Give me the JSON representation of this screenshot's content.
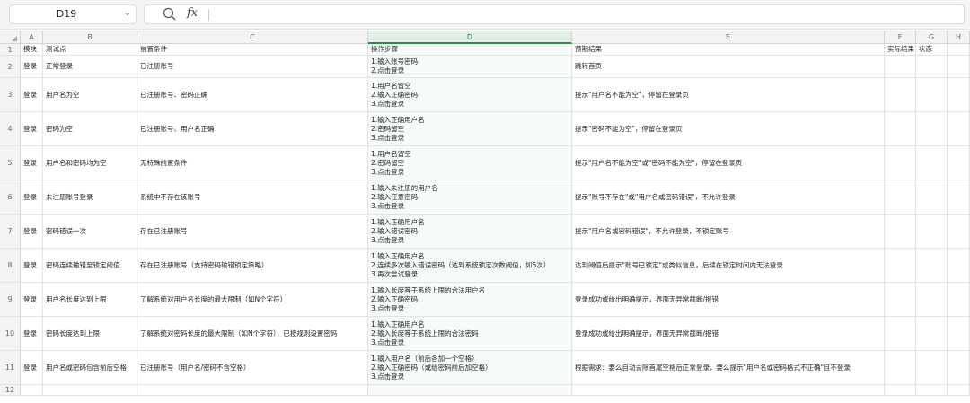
{
  "namebox": {
    "value": "D19"
  },
  "formula": {
    "value": ""
  },
  "columns": [
    "A",
    "B",
    "C",
    "D",
    "E",
    "F",
    "G",
    "H"
  ],
  "selected_column": "D",
  "headers": {
    "A": "模块",
    "B": "测试点",
    "C": "前置条件",
    "D": "操作步骤",
    "E": "预期结果",
    "F": "实际结果",
    "G": "状态"
  },
  "rows": [
    {
      "num": "2",
      "A": "登录",
      "B": "正常登录",
      "C": "已注册账号",
      "D": [
        "1.输入账号密码",
        "2.点击登录"
      ],
      "E": "跳转首页"
    },
    {
      "num": "3",
      "A": "登录",
      "B": "用户名为空",
      "C": "已注册账号、密码正确",
      "D": [
        "1.用户名留空",
        "2.输入正确密码",
        "3.点击登录"
      ],
      "E": "提示\"用户名不能为空\"，停留在登录页"
    },
    {
      "num": "4",
      "A": "登录",
      "B": "密码为空",
      "C": "已注册账号、用户名正确",
      "D": [
        "1.输入正确用户名",
        "2.密码留空",
        "3.点击登录"
      ],
      "E": "提示\"密码不能为空\"，停留在登录页"
    },
    {
      "num": "5",
      "A": "登录",
      "B": "用户名和密码均为空",
      "C": "无特殊前置条件",
      "D": [
        "1.用户名留空",
        "2.密码留空",
        "3.点击登录"
      ],
      "E": "提示\"用户名不能为空\"或\"密码不能为空\"，停留在登录页"
    },
    {
      "num": "6",
      "A": "登录",
      "B": "未注册账号登录",
      "C": "系统中不存在该账号",
      "D": [
        "1.输入未注册的用户名",
        "2.输入任意密码",
        "3.点击登录"
      ],
      "E": "提示\"账号不存在\"或\"用户名或密码错误\"，不允许登录"
    },
    {
      "num": "7",
      "A": "登录",
      "B": "密码错误一次",
      "C": "存在已注册账号",
      "D": [
        "1.输入正确用户名",
        "2.输入错误密码",
        "3.点击登录"
      ],
      "E": "提示\"用户名或密码错误\"，不允许登录，不锁定账号"
    },
    {
      "num": "8",
      "A": "登录",
      "B": "密码连续输错至锁定阈值",
      "C": "存在已注册账号（支持密码输错锁定策略）",
      "D": [
        "1.输入正确用户名",
        "2.连续多次输入错误密码（达到系统锁定次数阈值，如5次）",
        "3.再次尝试登录"
      ],
      "E": "达到阈值后提示\"账号已锁定\"或类似信息，后续在锁定时间内无法登录"
    },
    {
      "num": "9",
      "A": "登录",
      "B": "用户名长度达到上限",
      "C": "了解系统对用户名长度的最大限制（如N个字符）",
      "D": [
        "1.输入长度等于系统上限的合法用户名",
        "2.输入正确密码",
        "3.点击登录"
      ],
      "E": "登录成功或给出明确提示，界面无异常截断/报错"
    },
    {
      "num": "10",
      "A": "登录",
      "B": "密码长度达到上限",
      "C": "了解系统对密码长度的最大限制（如N个字符），已按规则设置密码",
      "D": [
        "1.输入正确用户名",
        "2.输入长度等于系统上限的合法密码",
        "3.点击登录"
      ],
      "E": "登录成功或给出明确提示，界面无异常截断/报错"
    },
    {
      "num": "11",
      "A": "登录",
      "B": "用户名或密码包含前后空格",
      "C": "已注册账号（用户名/密码不含空格）",
      "D": [
        "1.输入用户名（前后各加一个空格）",
        "2.输入正确密码（或给密码前后加空格）",
        "3.点击登录"
      ],
      "E": "根据需求：要么自动去除首尾空格后正常登录，要么提示\"用户名或密码格式不正确\"且不登录"
    },
    {
      "num": "12",
      "A": "",
      "B": "",
      "C": "",
      "D": [],
      "E": ""
    }
  ]
}
